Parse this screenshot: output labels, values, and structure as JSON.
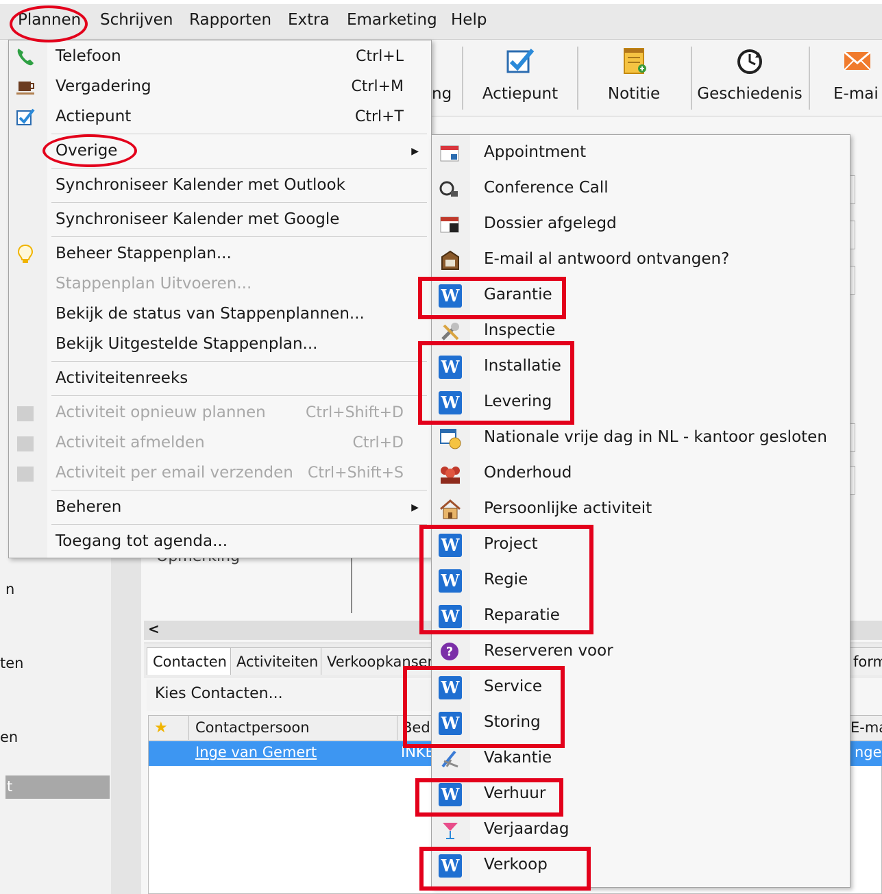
{
  "menubar": {
    "items": [
      "Plannen",
      "Schrijven",
      "Rapporten",
      "Extra",
      "Emarketing",
      "Help"
    ]
  },
  "toolbar": {
    "partial_label": "ng",
    "buttons": [
      {
        "label": "Actiepunt",
        "icon": "checkbox-icon"
      },
      {
        "label": "Notitie",
        "icon": "note-icon"
      },
      {
        "label": "Geschiedenis",
        "icon": "history-icon"
      },
      {
        "label": "E-mai",
        "icon": "email-icon"
      }
    ]
  },
  "background": {
    "left_fragments": [
      "n",
      "ten",
      "en",
      "t"
    ],
    "partial_text_under_menu": "Opmerking",
    "scroll_arrow": "<",
    "tabs": [
      "Contacten",
      "Activiteiten",
      "Verkoopkansen"
    ],
    "right_tab_fragment": "form",
    "kies": "Kies Contacten...",
    "grid_headers": [
      "Contactpersoon",
      "Bedr"
    ],
    "grid_header_right": "E-ma",
    "row": {
      "contact": "Inge van Gemert",
      "company": "INKE",
      "email_fragment": "nge"
    }
  },
  "main_menu": {
    "items": [
      {
        "label": "Telefoon",
        "shortcut": "Ctrl+L",
        "icon": "phone-icon"
      },
      {
        "label": "Vergadering",
        "shortcut": "Ctrl+M",
        "icon": "coffee-icon"
      },
      {
        "label": "Actiepunt",
        "shortcut": "Ctrl+T",
        "icon": "checkbox-icon"
      },
      {
        "label": "Overige",
        "submenu": true
      },
      {
        "label": "Synchroniseer Kalender met Outlook"
      },
      {
        "label": "Synchroniseer Kalender met Google"
      },
      {
        "label": "Beheer Stappenplan...",
        "icon": "lightbulb-icon"
      },
      {
        "label": "Stappenplan Uitvoeren...",
        "disabled": true
      },
      {
        "label": "Bekijk de status van Stappenplannen..."
      },
      {
        "label": "Bekijk Uitgestelde Stappenplan..."
      },
      {
        "label": "Activiteitenreeks"
      },
      {
        "label": "Activiteit opnieuw plannen",
        "shortcut": "Ctrl+Shift+D",
        "disabled": true
      },
      {
        "label": "Activiteit afmelden",
        "shortcut": "Ctrl+D",
        "disabled": true
      },
      {
        "label": "Activiteit per email verzenden",
        "shortcut": "Ctrl+Shift+S",
        "disabled": true
      },
      {
        "label": "Beheren",
        "submenu": true
      },
      {
        "label": "Toegang tot agenda..."
      }
    ],
    "submenu_arrow": "▶"
  },
  "sub_menu": {
    "items": [
      {
        "label": "Appointment",
        "icon": "calendar-icon"
      },
      {
        "label": "Conference Call",
        "icon": "conference-call-icon"
      },
      {
        "label": "Dossier afgelegd",
        "icon": "calendar-dark-icon"
      },
      {
        "label": "E-mail al antwoord ontvangen?",
        "icon": "mailbox-icon"
      },
      {
        "label": "Garantie",
        "icon": "w-icon"
      },
      {
        "label": "Inspectie",
        "icon": "tools-icon"
      },
      {
        "label": "Installatie",
        "icon": "w-icon"
      },
      {
        "label": "Levering",
        "icon": "w-icon"
      },
      {
        "label": "Nationale vrije dag in NL - kantoor gesloten",
        "icon": "calendar-clock-icon"
      },
      {
        "label": "Onderhoud",
        "icon": "group-icon"
      },
      {
        "label": "Persoonlijke activiteit",
        "icon": "house-icon"
      },
      {
        "label": "Project",
        "icon": "w-icon"
      },
      {
        "label": "Regie",
        "icon": "w-icon"
      },
      {
        "label": "Reparatie",
        "icon": "w-icon"
      },
      {
        "label": "Reserveren voor",
        "icon": "question-icon"
      },
      {
        "label": "Service",
        "icon": "w-icon"
      },
      {
        "label": "Storing",
        "icon": "w-icon"
      },
      {
        "label": "Vakantie",
        "icon": "beach-chair-icon"
      },
      {
        "label": "Verhuur",
        "icon": "w-icon"
      },
      {
        "label": "Verjaardag",
        "icon": "cocktail-icon"
      },
      {
        "label": "Verkoop",
        "icon": "w-icon"
      }
    ],
    "w_glyph": "W"
  },
  "colors": {
    "annotation_red": "#e3001b",
    "selection_blue": "#3d96f2",
    "w_icon_blue": "#1f6fd1"
  }
}
